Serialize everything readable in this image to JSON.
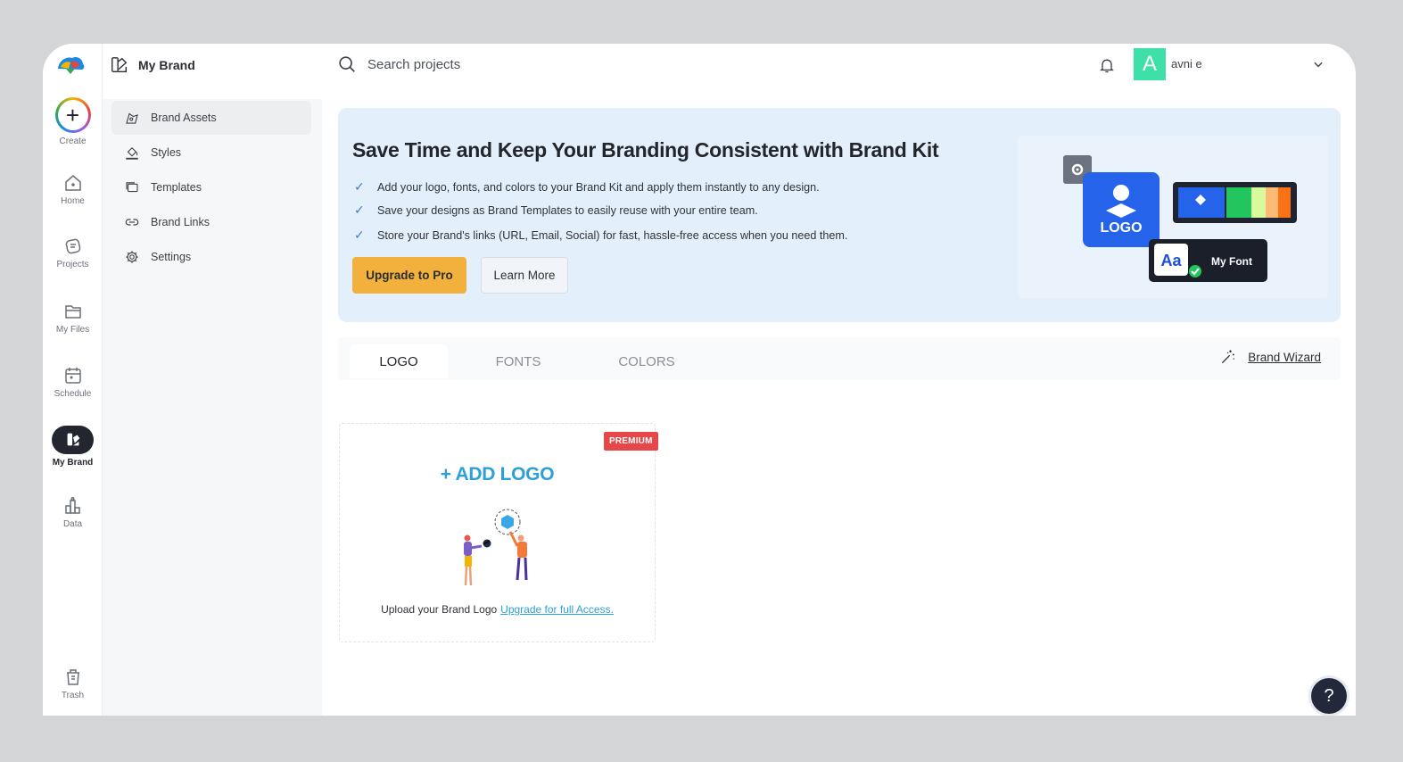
{
  "rail": {
    "create": "Create",
    "home": "Home",
    "projects": "Projects",
    "files": "My Files",
    "schedule": "Schedule",
    "brand": "My Brand",
    "data": "Data",
    "trash": "Trash"
  },
  "sidebar": {
    "title": "My Brand",
    "items": [
      {
        "label": "Brand Assets",
        "icon": "brand-assets-icon"
      },
      {
        "label": "Styles",
        "icon": "paint-bucket-icon"
      },
      {
        "label": "Templates",
        "icon": "templates-icon"
      },
      {
        "label": "Brand Links",
        "icon": "link-icon"
      },
      {
        "label": "Settings",
        "icon": "gear-icon"
      }
    ]
  },
  "topbar": {
    "search_placeholder": "Search projects",
    "avatar_letter": "A",
    "username": "avni e"
  },
  "banner": {
    "title": "Save Time and Keep Your Branding Consistent with Brand Kit",
    "bullets": [
      "Add your logo, fonts, and colors to your Brand Kit and apply them instantly to any design.",
      "Save your designs as Brand Templates to easily reuse with your entire team.",
      "Store your Brand's links (URL, Email, Social) for fast, hassle-free access when you need them."
    ],
    "upgrade_label": "Upgrade to Pro",
    "learn_label": "Learn More",
    "illus_logo": "LOGO",
    "illus_aa": "Aa",
    "illus_font": "My Font"
  },
  "tabs": {
    "items": [
      "LOGO",
      "FONTS",
      "COLORS"
    ],
    "active": "LOGO",
    "wizard_label": "Brand Wizard"
  },
  "logo_card": {
    "badge": "PREMIUM",
    "add_label": "+ ADD LOGO",
    "upload_text": "Upload your Brand Logo",
    "upgrade_link": "Upgrade for full Access."
  },
  "help_label": "?",
  "colors": {
    "accent": "#2f9fd8",
    "upgrade": "#f2b13d",
    "banner_bg": "#e3f0fb",
    "avatar": "#3ee0a7",
    "premium": "#e8474a"
  }
}
